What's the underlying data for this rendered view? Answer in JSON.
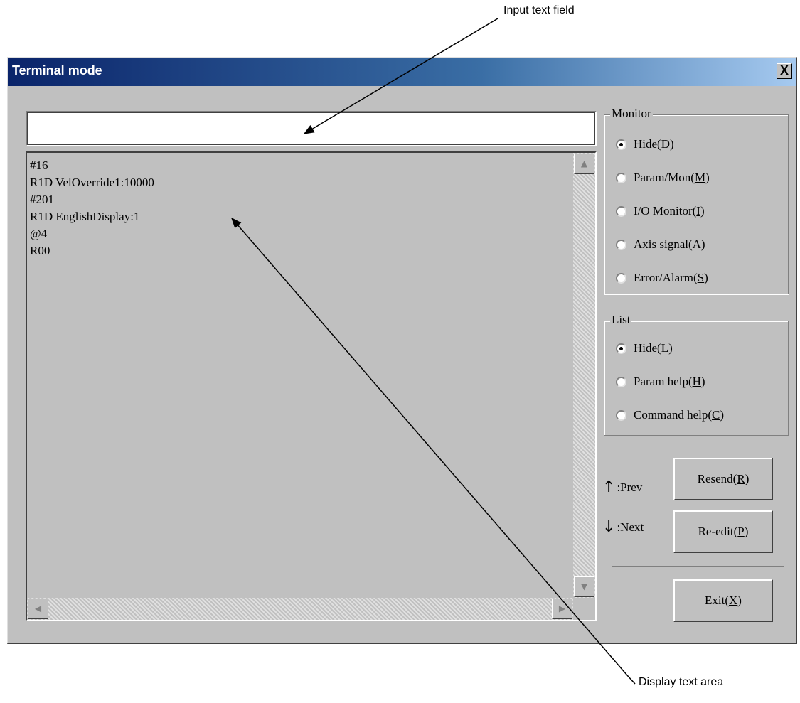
{
  "callouts": {
    "input_field": "Input text field",
    "display_area": "Display text area"
  },
  "window": {
    "title": "Terminal mode",
    "close_label": "X"
  },
  "input": {
    "value": ""
  },
  "display_lines": [
    "#16",
    "R1D VelOverride1:10000",
    "#201",
    "R1D EnglishDisplay:1",
    "@4",
    "R00"
  ],
  "monitor": {
    "title": "Monitor",
    "options": [
      {
        "label": "Hide(",
        "key": "D",
        "selected": true
      },
      {
        "label": "Param/Mon(",
        "key": "M",
        "selected": false
      },
      {
        "label": "I/O Monitor(",
        "key": "I",
        "selected": false
      },
      {
        "label": "Axis signal(",
        "key": "A",
        "selected": false
      },
      {
        "label": "Error/Alarm(",
        "key": "S",
        "selected": false
      }
    ]
  },
  "list": {
    "title": "List",
    "options": [
      {
        "label": "Hide(",
        "key": "L",
        "selected": true
      },
      {
        "label": "Param help(",
        "key": "H",
        "selected": false
      },
      {
        "label": "Command help(",
        "key": "C",
        "selected": false
      }
    ]
  },
  "hints": {
    "prev_arrow": "↑",
    "prev": ":Prev",
    "next_arrow": "↓",
    "next": ":Next"
  },
  "buttons": {
    "resend": {
      "label": "Resend(",
      "key": "R"
    },
    "reedit": {
      "label": "Re-edit(",
      "key": "P"
    },
    "exit": {
      "label": "Exit(",
      "key": "X"
    }
  }
}
